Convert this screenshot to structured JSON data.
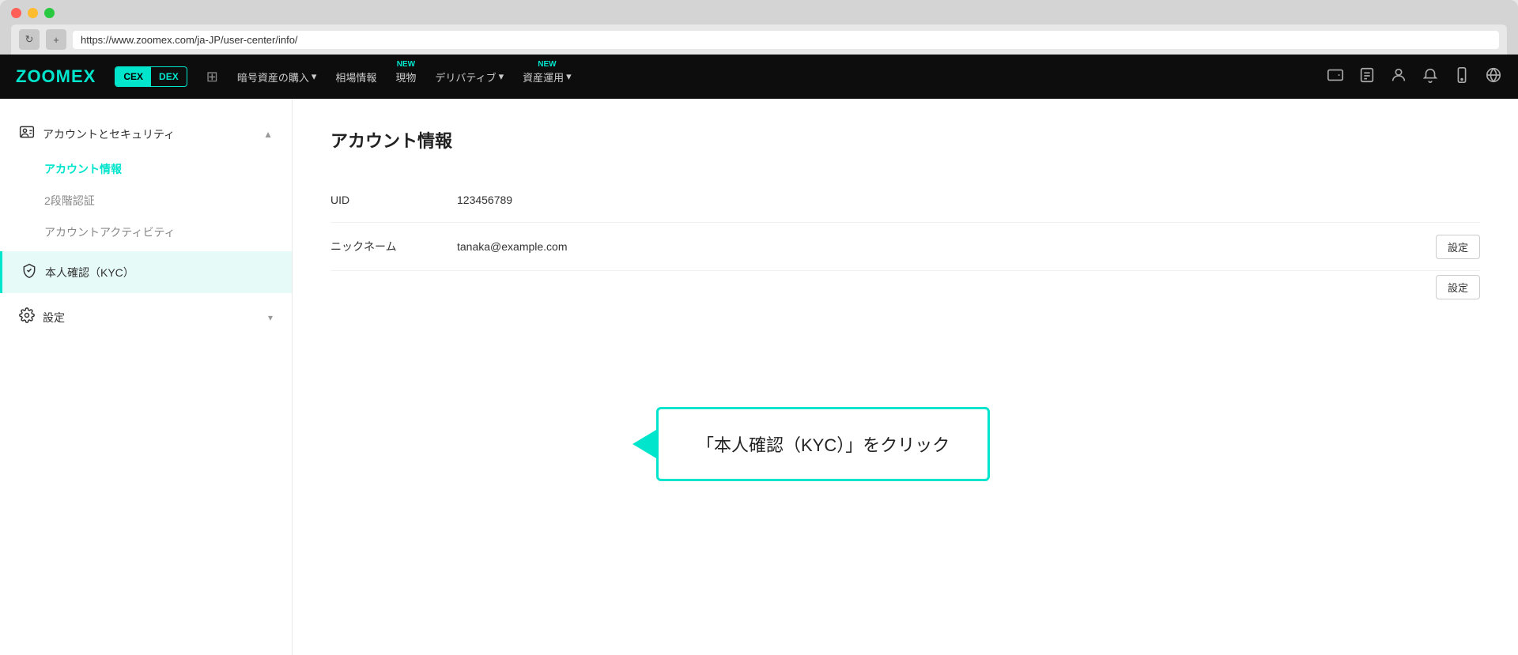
{
  "browser": {
    "url": "https://www.zoomex.com/ja-JP/user-center/info/",
    "reload_label": "↻",
    "new_tab_label": "+"
  },
  "nav": {
    "logo": "ZOOMEX",
    "exchange_cex": "CEX",
    "exchange_dex": "DEX",
    "items": [
      {
        "label": "暗号資産の購入",
        "has_dropdown": true,
        "new_badge": false
      },
      {
        "label": "相場情報",
        "has_dropdown": false,
        "new_badge": false
      },
      {
        "label": "現物",
        "has_dropdown": false,
        "new_badge": true
      },
      {
        "label": "デリバティブ",
        "has_dropdown": true,
        "new_badge": false
      },
      {
        "label": "資産運用",
        "has_dropdown": true,
        "new_badge": true
      }
    ],
    "icons": {
      "wallet": "🗂",
      "orders": "📋",
      "user": "👤",
      "bell": "🔔",
      "phone": "📱",
      "globe": "🌐"
    }
  },
  "sidebar": {
    "section_account": "アカウントとセキュリティ",
    "sub_items": [
      {
        "label": "アカウント情報",
        "active": true
      },
      {
        "label": "2段階認証",
        "active": false
      },
      {
        "label": "アカウントアクティビティ",
        "active": false
      }
    ],
    "kyc_label": "本人確認（KYC）",
    "settings_label": "設定"
  },
  "content": {
    "title": "アカウント情報",
    "rows": [
      {
        "label": "UID",
        "value": "123456789",
        "has_action": false
      },
      {
        "label": "ニックネーム",
        "value": "tanaka@example.com",
        "has_action": true,
        "action_label": "設定"
      },
      {
        "label": "",
        "value": "",
        "has_action": true,
        "action_label": "設定"
      }
    ]
  },
  "callout": {
    "text": "「本人確認（KYC）」をクリック"
  },
  "colors": {
    "accent": "#00e5cc",
    "bg_dark": "#0d0d0d"
  }
}
